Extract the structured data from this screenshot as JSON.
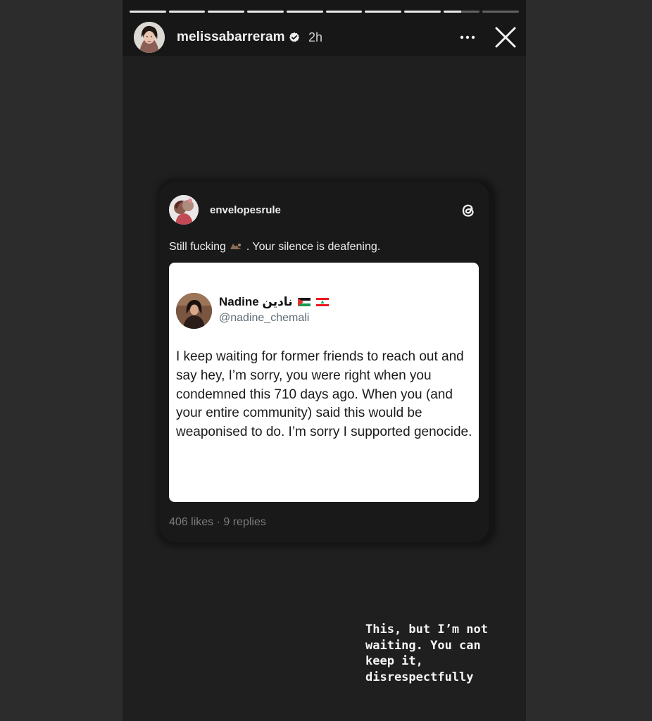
{
  "story": {
    "progress": {
      "segments": 10,
      "current_segment": 9,
      "current_fill_fraction": 0.5
    },
    "header": {
      "username": "melissabarreram",
      "verified": true,
      "time": "2h"
    },
    "card": {
      "username": "envelopesrule",
      "caption_before": "Still fucking",
      "caption_after": ". Your silence is deafening.",
      "tweet": {
        "name": "Nadine نادين",
        "handle": "@nadine_chemali",
        "body": "I keep waiting for former friends to reach out and say hey, I’m sorry, you were right when you condemned this 710 days ago. When you (and your entire community) said this would be weaponised to do. I’m sorry I supported genocide."
      },
      "stats": "406 likes · 9 replies"
    },
    "overlay_text": "This, but I’m not waiting. You can keep it, disrespectfully"
  },
  "icons": {
    "verified": "verified-badge-icon",
    "more": "more-options-icon",
    "close": "close-icon",
    "threads": "threads-logo-icon",
    "caption_emoji": "laughing-emoji-icon",
    "flag_1": "palestine-flag-icon",
    "flag_2": "lebanon-flag-icon"
  },
  "colors": {
    "story_background": "#1f1f1f",
    "card_background": "#191919",
    "tweet_background": "#ffffff",
    "muted_text": "#7c7c7c"
  }
}
